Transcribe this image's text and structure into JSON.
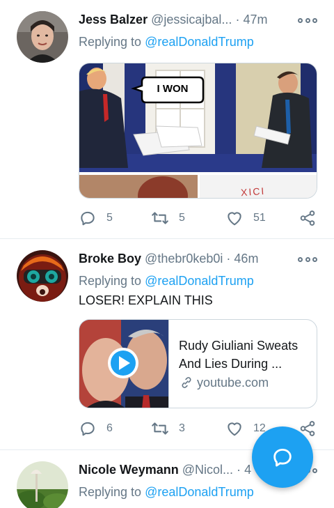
{
  "tweets": [
    {
      "name": "Jess Balzer",
      "handle": "@jessicajbal...",
      "dot": "·",
      "time": "47m",
      "replying_prefix": "Replying to",
      "replying_to": "@realDonaldTrump",
      "image_caption": "I WON",
      "image_bottom_text": "XICI",
      "replies": "5",
      "retweets": "5",
      "likes": "51"
    },
    {
      "name": "Broke Boy",
      "handle": "@thebr0keb0i",
      "dot": "·",
      "time": "46m",
      "replying_prefix": "Replying to",
      "replying_to": "@realDonaldTrump",
      "text": "LOSER! EXPLAIN THIS",
      "link_title": "Rudy Giuliani Sweats And Lies During ...",
      "link_domain": "youtube.com",
      "replies": "6",
      "retweets": "3",
      "likes": "12"
    },
    {
      "name": "Nicole Weymann",
      "handle": "@Nicol...",
      "dot": "·",
      "time": "4",
      "replying_prefix": "Replying to",
      "replying_to": "@realDonaldTrump"
    }
  ],
  "icons": {
    "reply": "reply-icon",
    "retweet": "retweet-icon",
    "like": "heart-icon",
    "share": "share-icon",
    "more": "more-icon",
    "compose": "compose-reply-icon",
    "link": "link-icon",
    "play": "play-icon"
  },
  "colors": {
    "accent": "#1da1f2",
    "secondary_text": "#657786",
    "primary_text": "#14171a",
    "divider": "#e6ecf0"
  }
}
